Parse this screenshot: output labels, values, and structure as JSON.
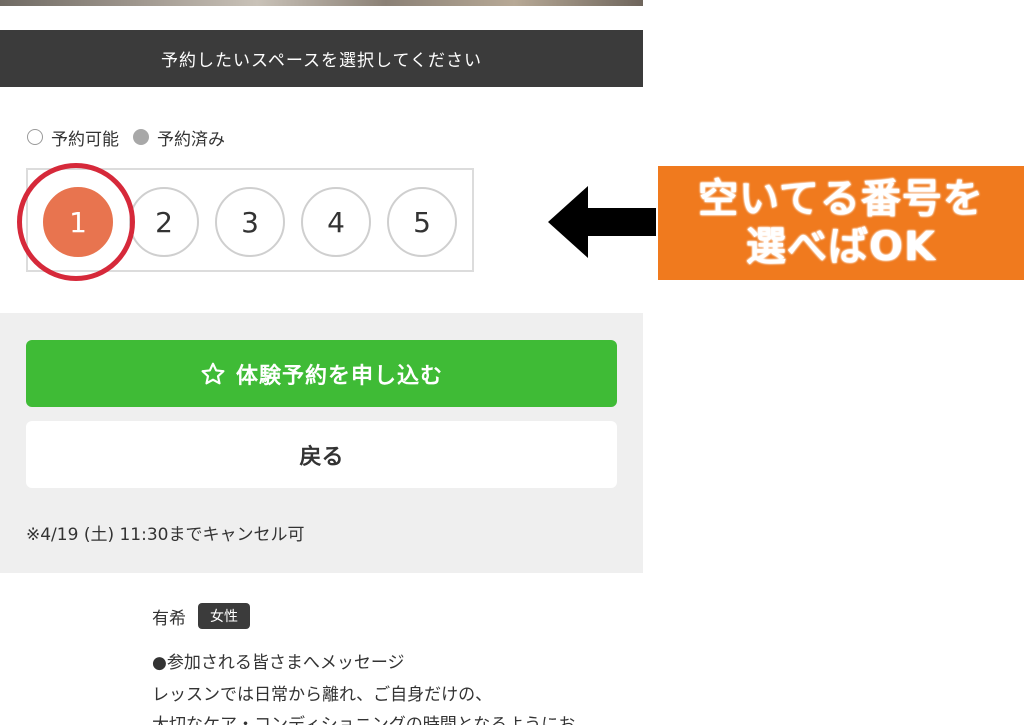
{
  "header": {
    "title": "予約したいスペースを選択してください"
  },
  "legend": {
    "available": "予約可能",
    "booked": "予約済み"
  },
  "slots": [
    {
      "label": "1",
      "selected": true
    },
    {
      "label": "2",
      "selected": false
    },
    {
      "label": "3",
      "selected": false
    },
    {
      "label": "4",
      "selected": false
    },
    {
      "label": "5",
      "selected": false
    }
  ],
  "actions": {
    "apply_label": "体験予約を申し込む",
    "back_label": "戻る"
  },
  "cancel_note": "※4/19 (土) 11:30までキャンセル可",
  "instructor": {
    "name": "有希",
    "badge": "女性"
  },
  "message": {
    "title": "●参加される皆さまへメッセージ",
    "line1": "レッスンでは日常から離れ、ご自身だけの、",
    "line2": "大切なケア・コンディショニングの時間となるようにお"
  },
  "annotation": {
    "line1": "空いてる番号を",
    "line2": "選べばOK"
  },
  "colors": {
    "header_bg": "#3b3b3b",
    "selected_slot": "#e8744f",
    "highlight_ring": "#d6293a",
    "apply_button": "#3fbb36",
    "callout_bg": "#f07a1e"
  },
  "icons": {
    "apply_button_icon": "star-outline-icon",
    "annotation_arrow": "arrow-left-icon"
  }
}
